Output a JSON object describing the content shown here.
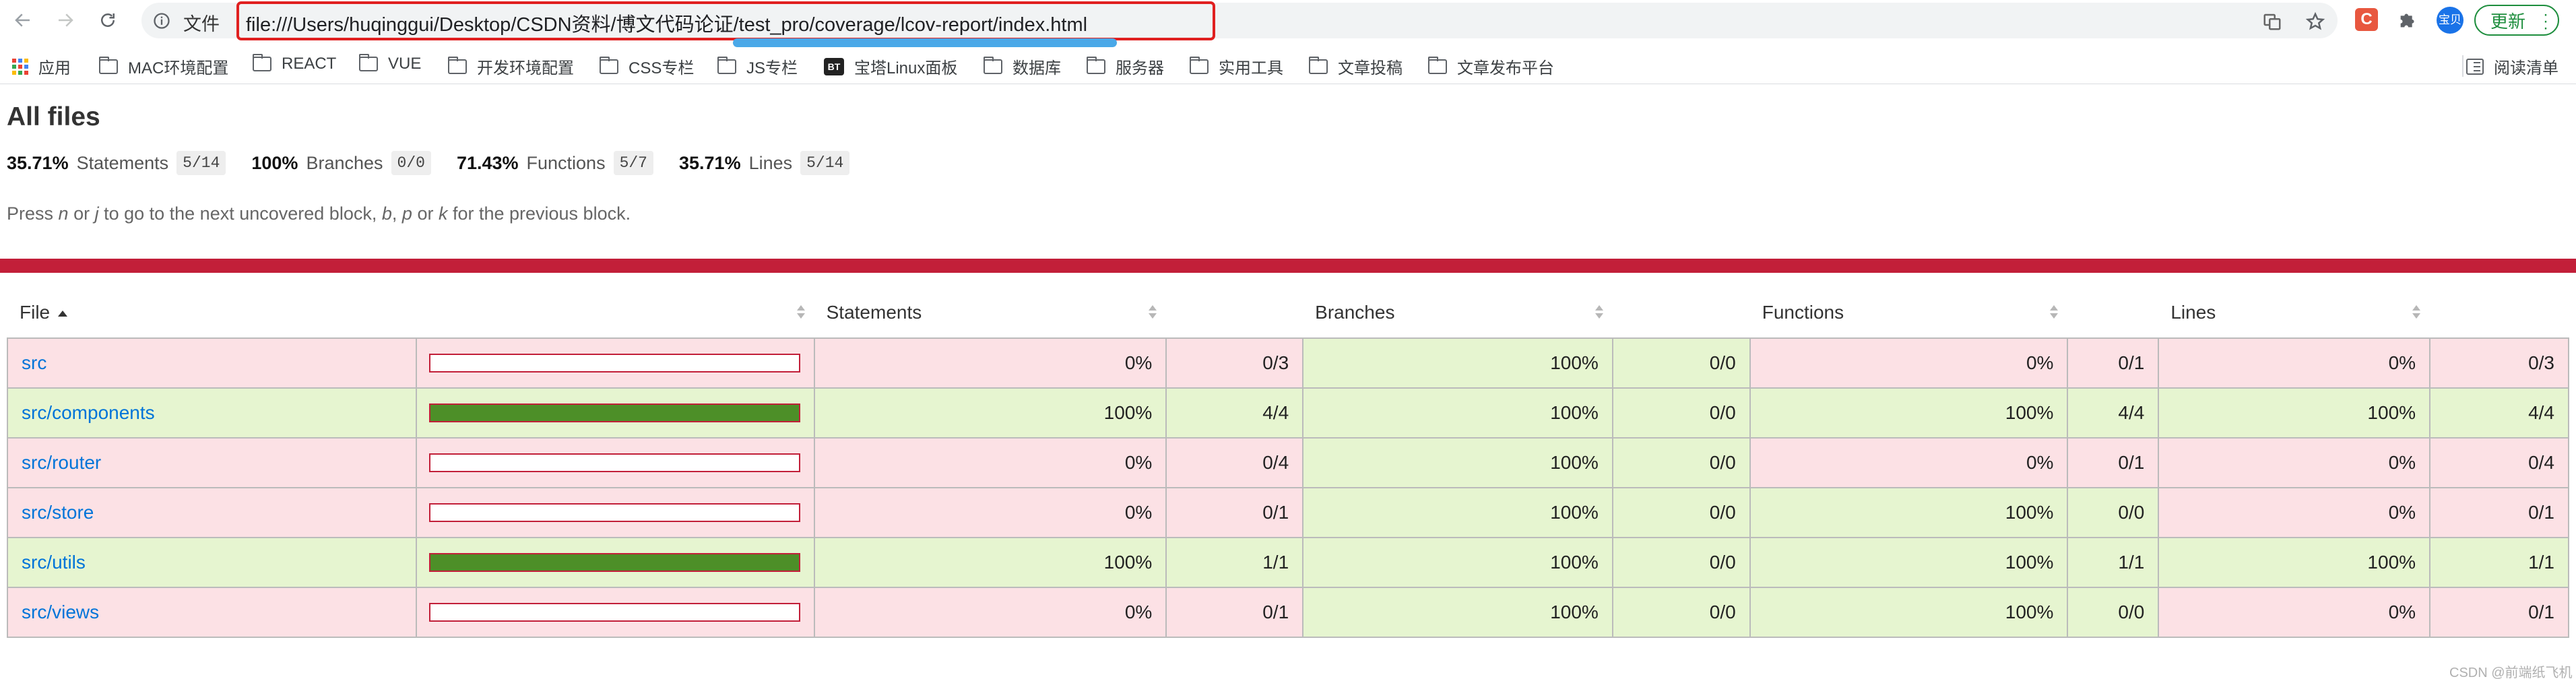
{
  "browser": {
    "file_chip": "文件",
    "url": "file:///Users/huqinggui/Desktop/CSDN资料/博文代码论证/test_pro/coverage/lcov-report/index.html",
    "extension_letter": "C",
    "avatar_text": "宝贝",
    "update_label": "更新"
  },
  "bookmarks": {
    "items": [
      {
        "label": "应用",
        "icon": "apps-grid-icon"
      },
      {
        "label": "MAC环境配置",
        "icon": "folder-icon"
      },
      {
        "label": "REACT",
        "icon": "folder-icon"
      },
      {
        "label": "VUE",
        "icon": "folder-icon"
      },
      {
        "label": "开发环境配置",
        "icon": "folder-icon"
      },
      {
        "label": "CSS专栏",
        "icon": "folder-icon"
      },
      {
        "label": "JS专栏",
        "icon": "folder-icon"
      },
      {
        "label": "宝塔Linux面板",
        "icon": "bt-icon",
        "badge": "BT"
      },
      {
        "label": "数据库",
        "icon": "folder-icon"
      },
      {
        "label": "服务器",
        "icon": "folder-icon"
      },
      {
        "label": "实用工具",
        "icon": "folder-icon"
      },
      {
        "label": "文章投稿",
        "icon": "folder-icon"
      },
      {
        "label": "文章发布平台",
        "icon": "folder-icon"
      }
    ],
    "reading_list": "阅读清单"
  },
  "report": {
    "title": "All files",
    "summary": {
      "statements": {
        "pct": "35.71%",
        "label": "Statements",
        "fraction": "5/14"
      },
      "branches": {
        "pct": "100%",
        "label": "Branches",
        "fraction": "0/0"
      },
      "functions": {
        "pct": "71.43%",
        "label": "Functions",
        "fraction": "5/7"
      },
      "lines": {
        "pct": "35.71%",
        "label": "Lines",
        "fraction": "5/14"
      }
    },
    "hint": {
      "p1": "Press ",
      "k1": "n",
      "p2": " or ",
      "k2": "j",
      "p3": " to go to the next uncovered block, ",
      "k3": "b",
      "p4": ", ",
      "k4": "p",
      "p5": " or ",
      "k5": "k",
      "p6": " for the previous block."
    },
    "status_color": "#c21f39",
    "columns": {
      "file": "File",
      "statements": "Statements",
      "branches": "Branches",
      "functions": "Functions",
      "lines": "Lines"
    },
    "rows": [
      {
        "file": "src",
        "status": "low",
        "coverage": 0,
        "stmt_pct": "0%",
        "stmt_frac": "0/3",
        "br_pct": "100%",
        "br_frac": "0/0",
        "fn_pct": "0%",
        "fn_frac": "0/1",
        "ln_pct": "0%",
        "ln_frac": "0/3"
      },
      {
        "file": "src/components",
        "status": "high",
        "coverage": 100,
        "stmt_pct": "100%",
        "stmt_frac": "4/4",
        "br_pct": "100%",
        "br_frac": "0/0",
        "fn_pct": "100%",
        "fn_frac": "4/4",
        "ln_pct": "100%",
        "ln_frac": "4/4"
      },
      {
        "file": "src/router",
        "status": "low",
        "coverage": 0,
        "stmt_pct": "0%",
        "stmt_frac": "0/4",
        "br_pct": "100%",
        "br_frac": "0/0",
        "fn_pct": "0%",
        "fn_frac": "0/1",
        "ln_pct": "0%",
        "ln_frac": "0/4"
      },
      {
        "file": "src/store",
        "status": "low",
        "coverage": 0,
        "stmt_pct": "0%",
        "stmt_frac": "0/1",
        "br_pct": "100%",
        "br_frac": "0/0",
        "fn_pct": "100%",
        "fn_frac": "0/0",
        "ln_pct": "0%",
        "ln_frac": "0/1"
      },
      {
        "file": "src/utils",
        "status": "high",
        "coverage": 100,
        "stmt_pct": "100%",
        "stmt_frac": "1/1",
        "br_pct": "100%",
        "br_frac": "0/0",
        "fn_pct": "100%",
        "fn_frac": "1/1",
        "ln_pct": "100%",
        "ln_frac": "1/1"
      },
      {
        "file": "src/views",
        "status": "low",
        "coverage": 0,
        "stmt_pct": "0%",
        "stmt_frac": "0/1",
        "br_pct": "100%",
        "br_frac": "0/0",
        "fn_pct": "100%",
        "fn_frac": "0/0",
        "ln_pct": "0%",
        "ln_frac": "0/1"
      }
    ]
  },
  "watermark": "CSDN @前端纸飞机"
}
